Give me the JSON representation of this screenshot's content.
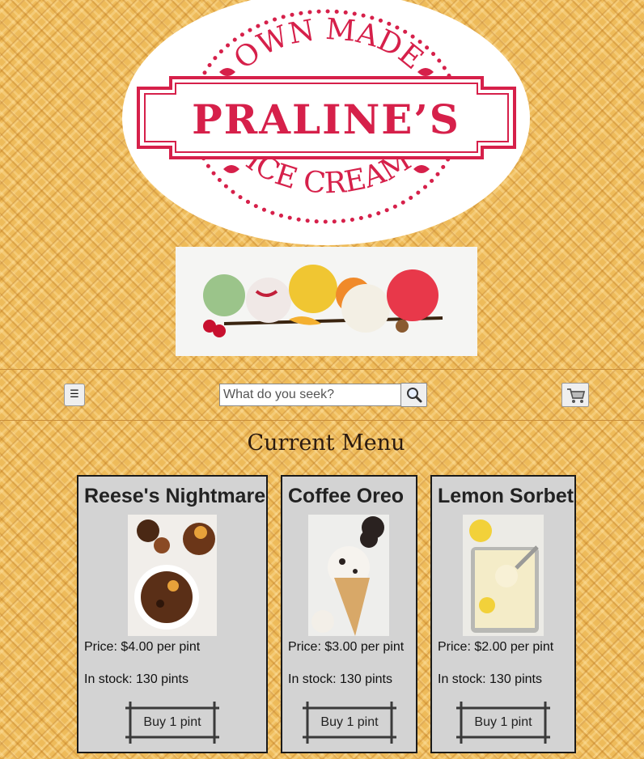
{
  "logo": {
    "line_top": "OWN MADE",
    "line_main": "PRALINE’S",
    "line_bottom": "ICE CREAM"
  },
  "nav": {
    "menu_icon": "☰",
    "search_placeholder": "What do you seek?",
    "search_icon": "magnifier-icon",
    "cart_icon": "cart-icon"
  },
  "heading": "Current Menu",
  "products": [
    {
      "name": "Reese's Nightmare",
      "price": "Price: $4.00 per pint",
      "stock": "In stock: 130 pints",
      "buy": "Buy 1 pint"
    },
    {
      "name": "Coffee Oreo",
      "price": "Price: $3.00 per pint",
      "stock": "In stock: 130 pints",
      "buy": "Buy 1 pint"
    },
    {
      "name": "Lemon Sorbet",
      "price": "Price: $2.00 per pint",
      "stock": "In stock: 130 pints",
      "buy": "Buy 1 pint"
    }
  ],
  "colors": {
    "brand_red": "#d6204a",
    "waffle": "#eebb5a",
    "card_bg": "#d3d3d3"
  }
}
